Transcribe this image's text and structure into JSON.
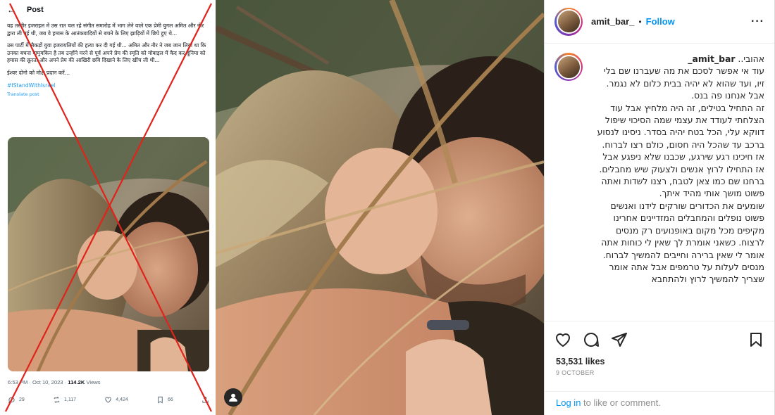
{
  "twitter": {
    "header": {
      "title": "Post"
    },
    "tweet_text": [
      "यह तस्वीर इजराइल में उस रात चल रहे संगीत समारोह में भाग लेने वाले एक प्रेमी युगल अमित और नीर द्वारा ली गई थी, जब वे हमास के आतंकवादियों से बचने के लिए झाड़ियों में छिपे हुए थे...",
      "उस पार्टी में सैकड़ों युवा इजरायलियों की हत्या कर दी गई थी... अमित और नीर ने जब जान लिया था कि उनका बचना नामुमकिन है तब उन्होंने मरने से पूर्व अपने प्रेम की स्मृति को मोबाइल में कैद कर दुनिया को हमास की क्रूरता और अपने प्रेम की आखिरी छवि दिखाने के लिए खींच ली थी...",
      "ईश्वर दोनो को मोक्ष प्रदान करें..."
    ],
    "hashtag": "#IStandWithIsrael",
    "translate_label": "Translate post",
    "timestamp": "6:53 PM · Oct 10, 2023 · ",
    "views_count": "114.2K",
    "views_label": " Views",
    "replies": "29",
    "reposts": "1,117",
    "likes": "4,424",
    "bookmarks": "66"
  },
  "instagram": {
    "username": "amit_bar_",
    "follow_label": "Follow",
    "caption_greeting": "אהובי.. ",
    "caption_lines": [
      "עוד אי אפשר לסכם את מה שעברנו שם בלי זיו, ועד שהוא לא יהיה בבית כלום לא נגמר.",
      "אבל אנחנו פה בנס.",
      "זה התחיל בטילים, זה היה מלחיץ אבל עוד הצלחתי לעודד את עצמי שמה הסיכוי שיפול דווקא עלי, הכל בטח יהיה בסדר. ניסינו לנסוע ברכב עד שהכל היה חסום, כולם רצו לברוח. אז חיכינו רגע שירגע, שכבנו שלא ניפגע אבל אז התחילו לרוץ אנשים ולצעוק שיש מחבלים.",
      "ברחנו שם כמו צאן לטבח, רצנו לשדות ואתה פשוט מושך אותי מהיד איתך.",
      "שומעים את הכדורים שורקים לידנו ואנשים פשוט נופלים והמחבלים המזדיינים אחרינו מקיפים מכל מקום באופנועים רק מנסים לרצוח. כשאני אומרת לך שאין לי כוחות אתה אומר לי שאין ברירה וחייבים להמשיך לברוח. מנסים לעלות על טרמפים אבל אתה אומר שצריך להמשיך לרוץ ולהתחבא"
    ],
    "likes_label": "53,531 likes",
    "date_label": "9 OCTOBER",
    "login_link": "Log in",
    "login_suffix": " to like or comment."
  },
  "colors": {
    "twitter_blue": "#1d9bf0",
    "instagram_blue": "#0095f6",
    "cross_red": "#e0231b"
  },
  "icons": [
    "back-arrow-icon",
    "reply-icon",
    "repost-icon",
    "like-heart-icon",
    "bookmark-icon",
    "share-icon",
    "more-options-icon",
    "comment-icon",
    "send-icon",
    "save-icon",
    "user-tag-icon"
  ]
}
